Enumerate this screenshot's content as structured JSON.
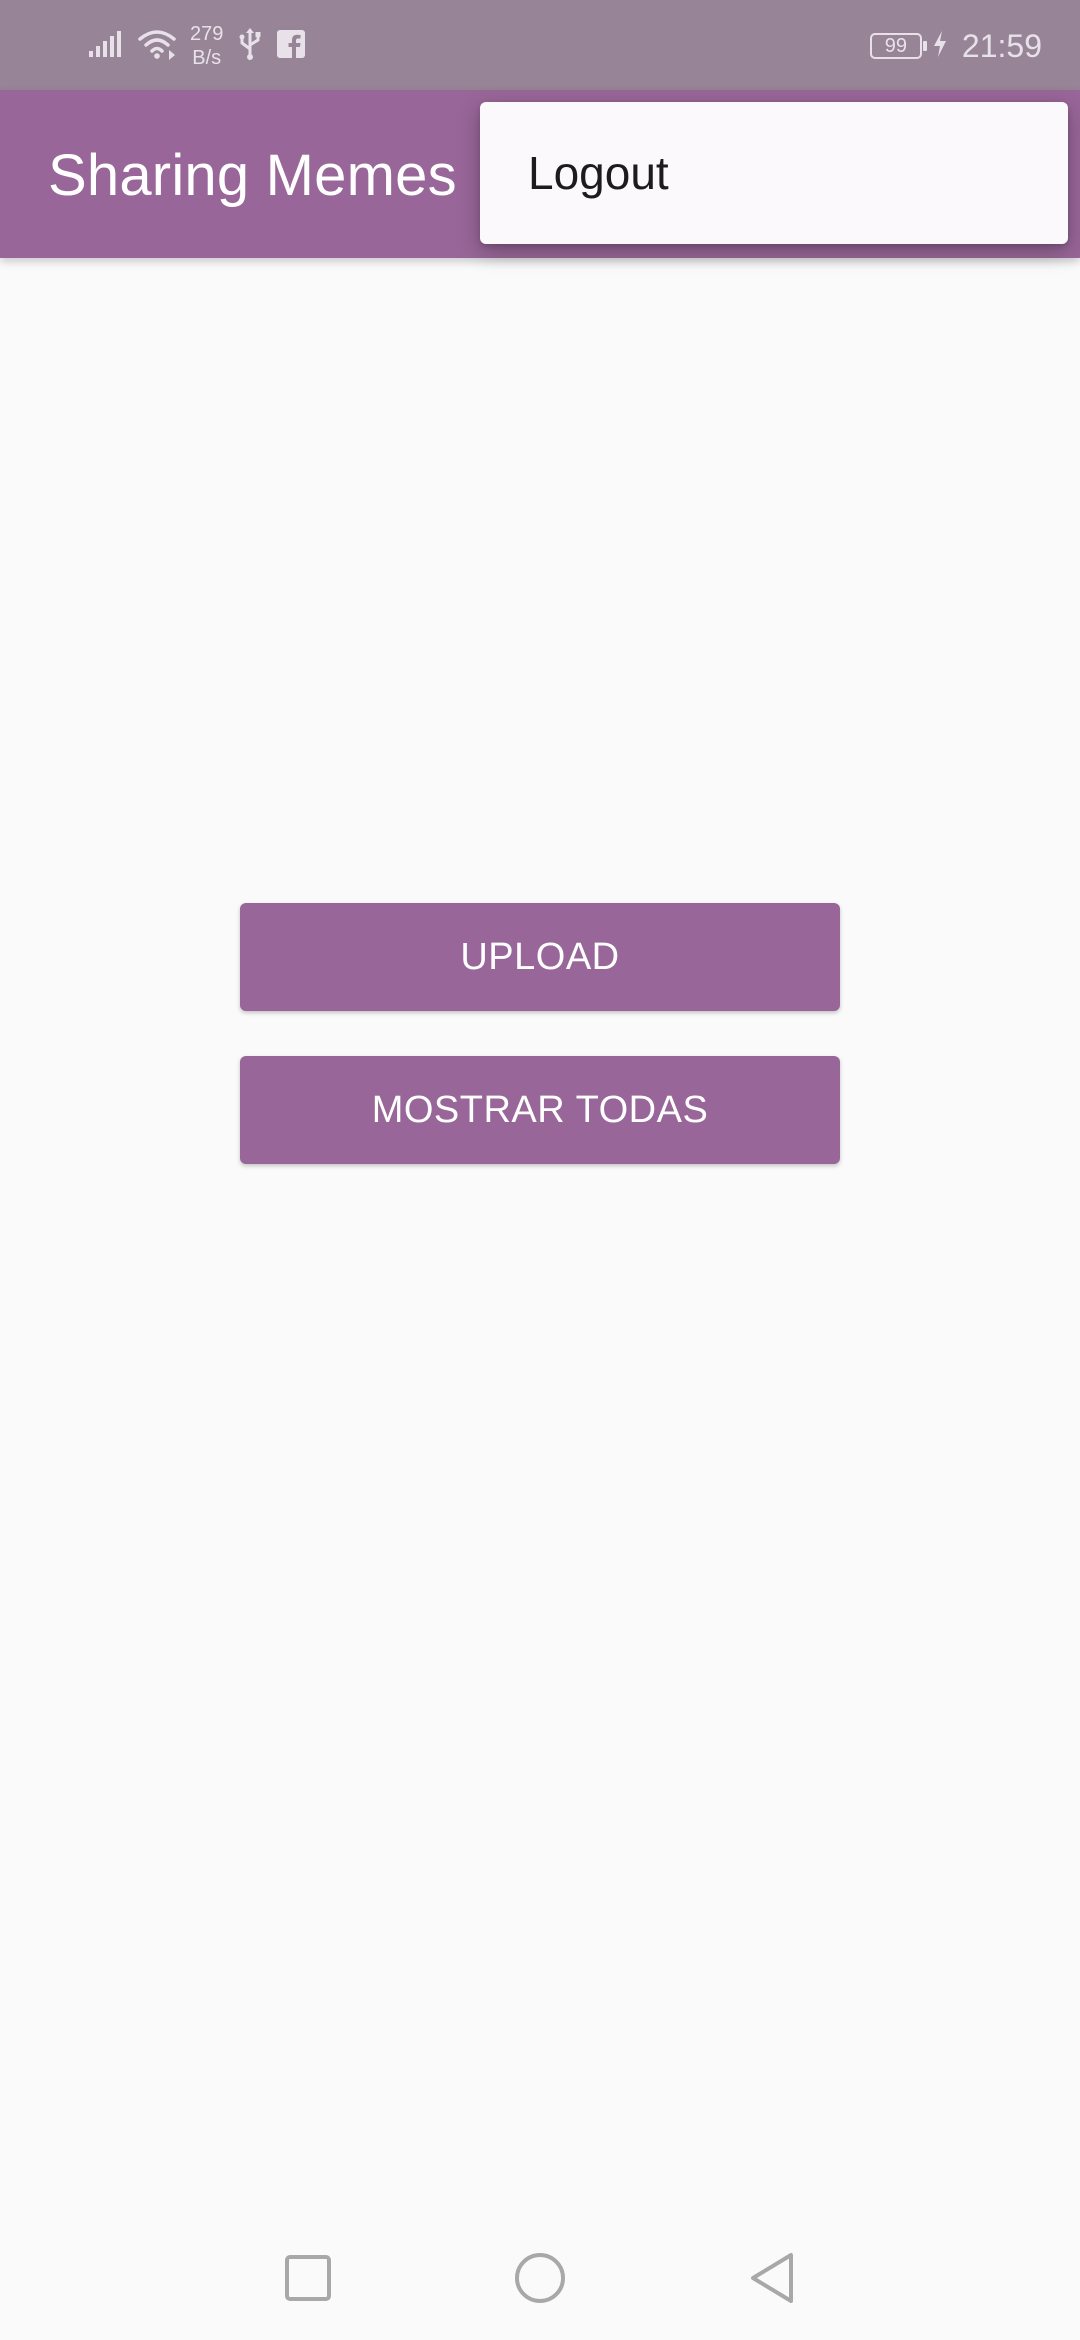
{
  "status_bar": {
    "net_speed_value": "279",
    "net_speed_unit": "B/s",
    "battery_level": "99",
    "time": "21:59",
    "icons": [
      "signal-icon",
      "wifi-icon",
      "usb-icon",
      "facebook-icon",
      "battery-icon",
      "charging-icon"
    ]
  },
  "app_bar": {
    "title": "Sharing Memes"
  },
  "overflow_menu": {
    "items": [
      {
        "label": "Logout"
      }
    ]
  },
  "main": {
    "upload_label": "UPLOAD",
    "show_all_label": "MOSTRAR TODAS"
  },
  "nav_bar": {
    "icons": [
      "recent-apps-icon",
      "home-icon",
      "back-icon"
    ]
  },
  "colors": {
    "primary": "#986698",
    "status_bar": "#978597",
    "background": "#fafafa",
    "menu_background": "#fcf9fc"
  }
}
